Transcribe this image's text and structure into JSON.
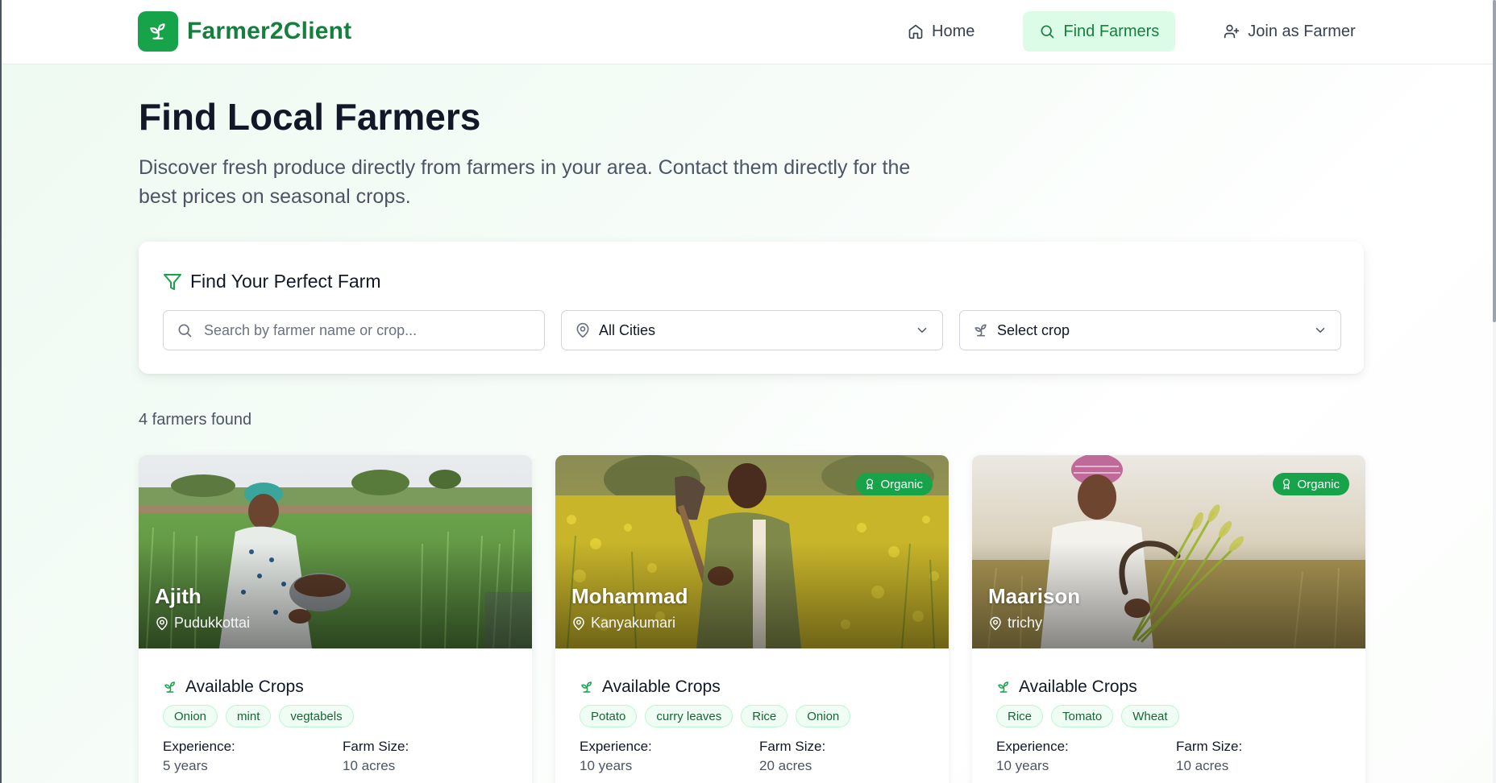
{
  "brand": {
    "name": "Farmer2Client"
  },
  "nav": {
    "home": "Home",
    "find": "Find Farmers",
    "join": "Join as Farmer"
  },
  "hero": {
    "title": "Find Local Farmers",
    "subtitle": "Discover fresh produce directly from farmers in your area. Contact them directly for the best prices on seasonal crops."
  },
  "filters": {
    "title": "Find Your Perfect Farm",
    "search_placeholder": "Search by farmer name or crop...",
    "city_value": "All Cities",
    "crop_value": "Select crop"
  },
  "results": {
    "count_text": "4 farmers found"
  },
  "farmers": [
    {
      "name": "Ajith",
      "city": "Pudukkottai",
      "organic": "",
      "crops_title": "Available Crops",
      "crops": [
        "Onion",
        "mint",
        "vegtabels"
      ],
      "experience_label": "Experience:",
      "experience": "5 years",
      "farm_size_label": "Farm Size:",
      "farm_size": "10 acres"
    },
    {
      "name": "Mohammad",
      "city": "Kanyakumari",
      "organic": "Organic",
      "crops_title": "Available Crops",
      "crops": [
        "Potato",
        "curry leaves",
        "Rice",
        "Onion"
      ],
      "experience_label": "Experience:",
      "experience": "10 years",
      "farm_size_label": "Farm Size:",
      "farm_size": "20 acres"
    },
    {
      "name": "Maarison",
      "city": "trichy",
      "organic": "Organic",
      "crops_title": "Available Crops",
      "crops": [
        "Rice",
        "Tomato",
        "Wheat"
      ],
      "experience_label": "Experience:",
      "experience": "10 years",
      "farm_size_label": "Farm Size:",
      "farm_size": "10 acres"
    }
  ],
  "colors": {
    "brand": "#16a34a",
    "brand_dark": "#15803d",
    "nav_active_bg": "#dcfce7",
    "tag_bg": "#f0fdf4"
  },
  "icons": {
    "brand": "sprout-icon",
    "home": "home-icon",
    "find": "search-icon",
    "join": "user-plus-icon",
    "filter": "filter-icon",
    "city": "map-pin-icon",
    "crop": "sprout-icon",
    "chevron": "chevron-down-icon",
    "organic": "award-icon"
  }
}
